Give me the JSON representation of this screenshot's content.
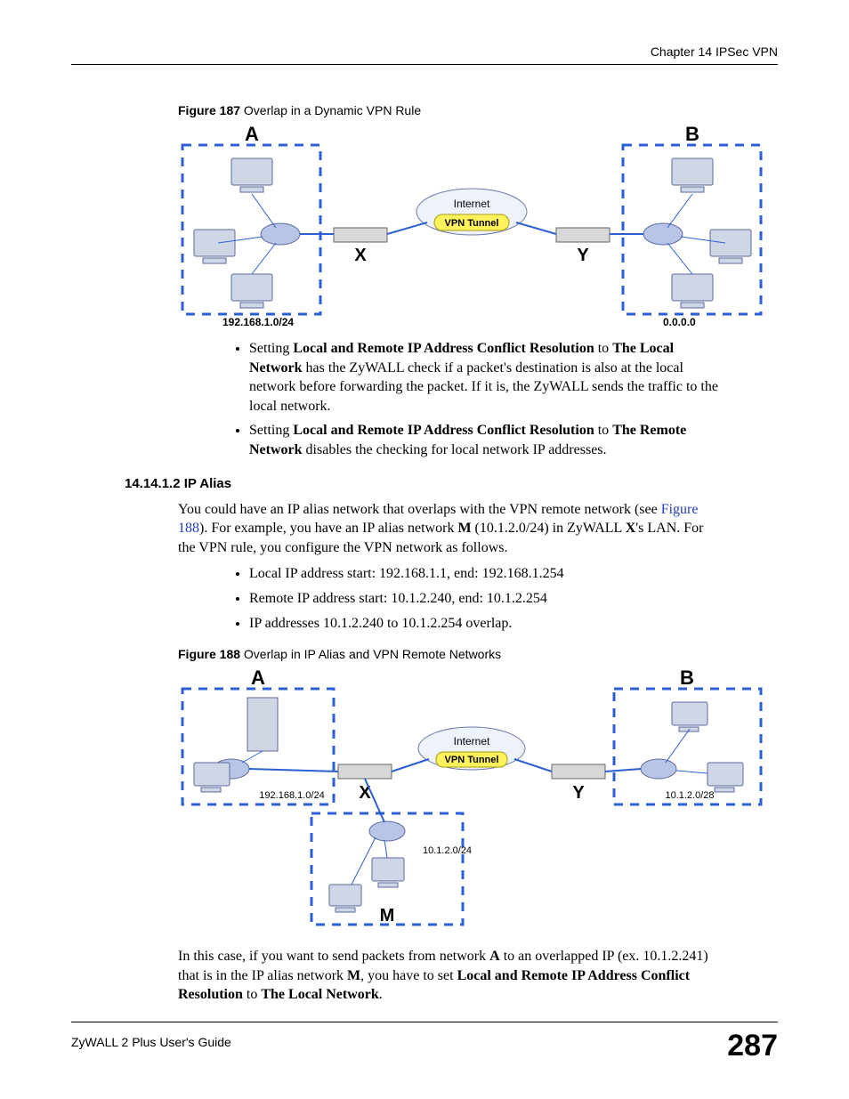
{
  "header": {
    "chapter": "Chapter 14 IPSec VPN"
  },
  "fig187": {
    "caption_prefix": "Figure 187",
    "caption_rest": "   Overlap in a Dynamic VPN Rule",
    "label_A": "A",
    "label_B": "B",
    "label_X": "X",
    "label_Y": "Y",
    "internet": "Internet",
    "tunnel": "VPN Tunnel",
    "net_left": "192.168.1.0/24",
    "net_right": "0.0.0.0"
  },
  "bullets1": {
    "b1_pre": "Setting ",
    "b1_b1": "Local and Remote IP Address Conflict Resolution",
    "b1_mid": " to ",
    "b1_b2": "The Local Network",
    "b1_post": " has the ZyWALL check if a packet's destination is also at the local network before forwarding the packet. If it is, the ZyWALL sends the traffic to the local network.",
    "b2_pre": "Setting ",
    "b2_b1": "Local and Remote IP Address Conflict Resolution",
    "b2_mid": " to ",
    "b2_b2": "The Remote Network",
    "b2_post": " disables the checking for local network IP addresses."
  },
  "section": {
    "num_title": "14.14.1.2  IP Alias"
  },
  "para1": {
    "t1": "You could have an IP alias network that overlaps with the VPN remote network (see ",
    "link": "Figure 188",
    "t2": "). For example, you have an IP alias network ",
    "b1": "M",
    "t3": " (10.1.2.0/24) in ZyWALL ",
    "b2": "X",
    "t4": "'s LAN. For the VPN rule, you configure the VPN network as follows."
  },
  "bullets2": {
    "li1": "Local IP address start: 192.168.1.1, end: 192.168.1.254",
    "li2": "Remote IP address start: 10.1.2.240, end: 10.1.2.254",
    "li3": "IP addresses 10.1.2.240 to 10.1.2.254 overlap."
  },
  "fig188": {
    "caption_prefix": "Figure 188",
    "caption_rest": "   Overlap in IP Alias and VPN Remote Networks",
    "label_A": "A",
    "label_B": "B",
    "label_X": "X",
    "label_Y": "Y",
    "label_M": "M",
    "internet": "Internet",
    "tunnel": "VPN Tunnel",
    "net_left": "192.168.1.0/24",
    "net_right": "10.1.2.0/28",
    "net_m": "10.1.2.0/24"
  },
  "para2": {
    "t1": "In this case, if you want to send packets from network ",
    "b1": "A",
    "t2": " to an overlapped IP (ex. 10.1.2.241) that is in the IP alias network ",
    "b2": "M",
    "t3": ", you have to set ",
    "b3": "Local and Remote IP Address Conflict Resolution",
    "t4": " to ",
    "b4": "The Local Network",
    "t5": "."
  },
  "footer": {
    "guide": "ZyWALL 2 Plus User's Guide",
    "page": "287"
  }
}
